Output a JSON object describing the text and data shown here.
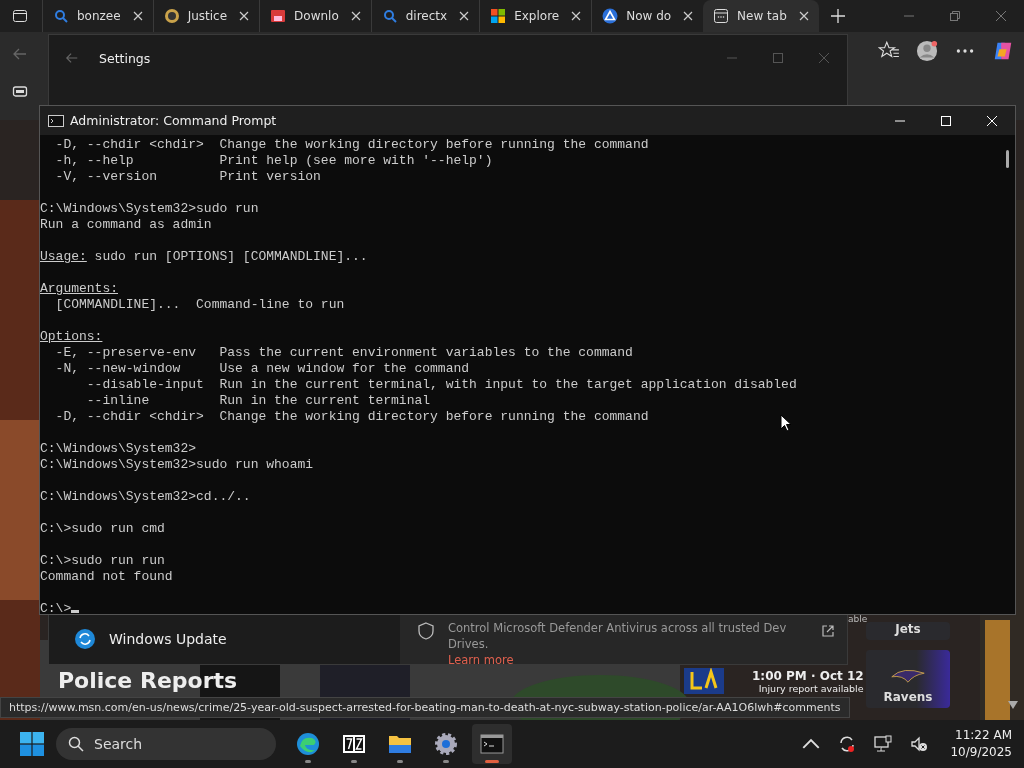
{
  "browser": {
    "tabs": [
      {
        "label": "bonzee",
        "selected": false
      },
      {
        "label": "Justice",
        "selected": false
      },
      {
        "label": "Downlo",
        "selected": false
      },
      {
        "label": "directx",
        "selected": false
      },
      {
        "label": "Explore",
        "selected": false
      },
      {
        "label": "Now do",
        "selected": false
      },
      {
        "label": "New tab",
        "selected": true
      }
    ],
    "page": {
      "headline": "Police Reports",
      "game_time": "1:00 PM · Oct 12",
      "game_note": "Injury report available",
      "cut_text": "able",
      "teams": [
        "Jets",
        "Ravens"
      ]
    },
    "status_url": "https://www.msn.com/en-us/news/crime/25-year-old-suspect-arrested-for-beating-man-to-death-at-nyc-subway-station-police/ar-AA1O6lwh#comments"
  },
  "settings": {
    "title": "Settings",
    "update_item": "Windows Update",
    "defender_text": "Control Microsoft Defender Antivirus across all trusted Dev Drives.",
    "defender_link": "Learn more"
  },
  "console": {
    "title": "Administrator: Command Prompt",
    "lines": [
      {
        "kind": "text",
        "text": "  -D, --chdir <chdir>  Change the working directory before running the command"
      },
      {
        "kind": "text",
        "text": "  -h, --help           Print help (see more with '--help')"
      },
      {
        "kind": "text",
        "text": "  -V, --version        Print version"
      },
      {
        "kind": "blank"
      },
      {
        "kind": "text",
        "text": "C:\\Windows\\System32>sudo run"
      },
      {
        "kind": "text",
        "text": "Run a command as admin"
      },
      {
        "kind": "blank"
      },
      {
        "kind": "heading",
        "heading": "Usage:",
        "text": " sudo run [OPTIONS] [COMMANDLINE]..."
      },
      {
        "kind": "blank"
      },
      {
        "kind": "heading",
        "heading": "Arguments:"
      },
      {
        "kind": "text",
        "text": "  [COMMANDLINE]...  Command-line to run"
      },
      {
        "kind": "blank"
      },
      {
        "kind": "heading",
        "heading": "Options:"
      },
      {
        "kind": "text",
        "text": "  -E, --preserve-env   Pass the current environment variables to the command"
      },
      {
        "kind": "text",
        "text": "  -N, --new-window     Use a new window for the command"
      },
      {
        "kind": "text",
        "text": "      --disable-input  Run in the current terminal, with input to the target application disabled"
      },
      {
        "kind": "text",
        "text": "      --inline         Run in the current terminal"
      },
      {
        "kind": "text",
        "text": "  -D, --chdir <chdir>  Change the working directory before running the command"
      },
      {
        "kind": "blank"
      },
      {
        "kind": "text",
        "text": "C:\\Windows\\System32>"
      },
      {
        "kind": "text",
        "text": "C:\\Windows\\System32>sudo run whoami"
      },
      {
        "kind": "blank"
      },
      {
        "kind": "text",
        "text": "C:\\Windows\\System32>cd../.."
      },
      {
        "kind": "blank"
      },
      {
        "kind": "text",
        "text": "C:\\>sudo run cmd"
      },
      {
        "kind": "blank"
      },
      {
        "kind": "text",
        "text": "C:\\>sudo run run"
      },
      {
        "kind": "text",
        "text": "Command not found"
      },
      {
        "kind": "blank"
      },
      {
        "kind": "prompt",
        "text": "C:\\>"
      }
    ]
  },
  "taskbar": {
    "search_placeholder": "Search",
    "apps": [
      {
        "selected": false
      },
      {
        "selected": false
      },
      {
        "selected": false
      },
      {
        "selected": false
      },
      {
        "selected": true
      }
    ],
    "time": "11:22 AM",
    "date": "10/9/2025"
  }
}
